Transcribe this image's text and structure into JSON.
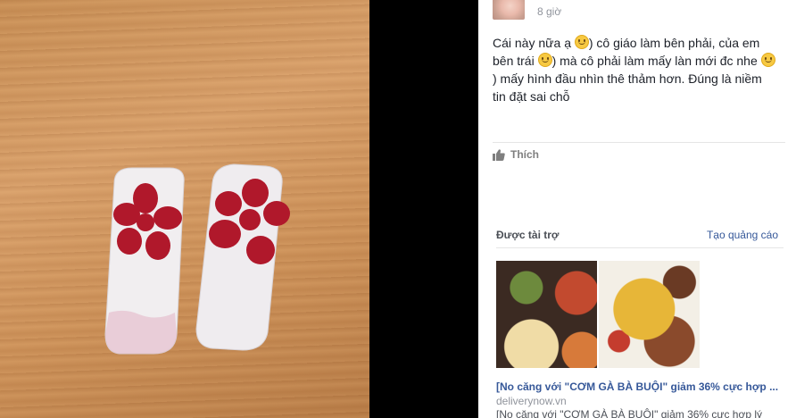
{
  "post": {
    "timestamp": "8 giờ",
    "text_parts": [
      "Cái này nữa ạ ",
      ") cô giáo làm bên phải, của em bên trái ",
      ") mà cô phải làm mấy làn mới đc nhe ",
      ") mấy hình đầu nhìn thê thảm hơn. Đúng là niềm tin đặt sai chỗ"
    ],
    "emoji_icon": "smile-emoji-icon"
  },
  "actions": {
    "like_label": "Thích",
    "like_icon": "thumbs-up-icon"
  },
  "sponsored": {
    "label": "Được tài trợ",
    "create_ad": "Tạo quảng cáo",
    "ad": {
      "title": "[No căng với \"CƠM GÀ BÀ BUỘI\" giảm 36% cực hợp ...",
      "domain": "deliverynow.vn",
      "description": "[No căng với \"CƠM GÀ BÀ BUỘI\" giảm 36% cực hợp lý"
    }
  },
  "colors": {
    "flower": "#b0182b",
    "link": "#365899",
    "background": "#000000"
  }
}
